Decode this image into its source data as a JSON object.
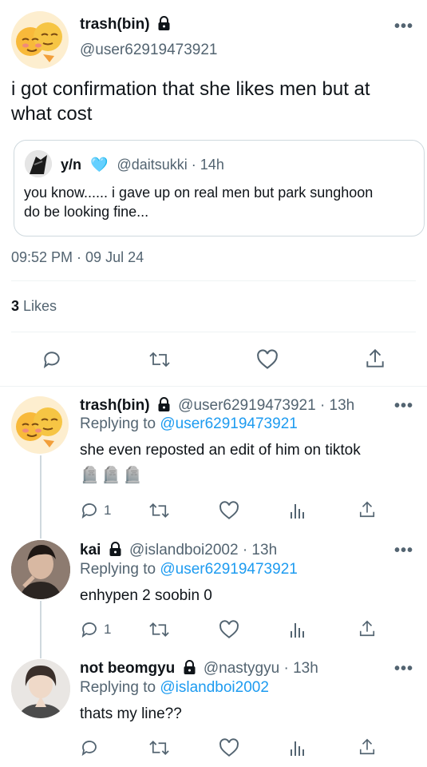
{
  "main_tweet": {
    "display_name": "trash(bin)",
    "handle": "@user62919473921",
    "text": "i got confirmation that she likes men but at what cost",
    "quoted": {
      "display_name": "y/n",
      "badge": "🩵",
      "handle": "@daitsukki",
      "time": "14h",
      "text": "you know...... i gave up on real men but park sunghoon do be looking fine..."
    },
    "timestamp": "09:52 PM · 09 Jul 24",
    "likes_count": "3",
    "likes_label": "Likes"
  },
  "replies": [
    {
      "display_name": "trash(bin)",
      "handle": "@user62919473921",
      "time": "· 13h",
      "replying_prefix": "Replying to",
      "replying_to": "@user62919473921",
      "text": "she even reposted an edit of him on tiktok",
      "emojis": "🪦🪦🪦",
      "reply_count": "1"
    },
    {
      "display_name": "kai",
      "handle": "@islandboi2002",
      "time": "· 13h",
      "replying_prefix": "Replying to",
      "replying_to": "@user62919473921",
      "text": "enhypen 2 soobin 0",
      "reply_count": "1"
    },
    {
      "display_name": "not beomgyu",
      "handle": "@nastygyu",
      "time": "· 13h",
      "replying_prefix": "Replying to",
      "replying_to": "@islandboi2002",
      "text": "thats my line??",
      "reply_count": ""
    }
  ],
  "icons": {
    "more": "more-icon",
    "reply": "reply-icon",
    "retweet": "retweet-icon",
    "like": "heart-icon",
    "views": "views-icon",
    "share": "share-icon",
    "lock": "lock-icon"
  },
  "colors": {
    "accent": "#1d9bf0",
    "secondary_text": "#536471",
    "divider": "#eff3f4"
  }
}
